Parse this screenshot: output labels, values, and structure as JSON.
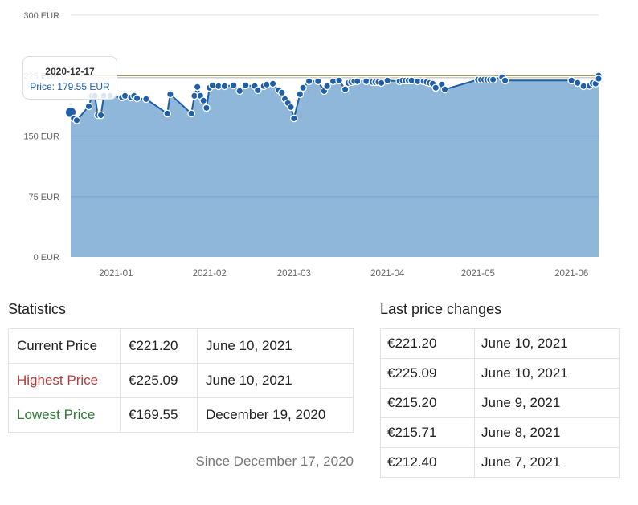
{
  "chart_data": {
    "type": "area",
    "title": "",
    "xlabel": "",
    "ylabel": "",
    "ylim": [
      0,
      300
    ],
    "xlim": [
      "2020-12-17",
      "2021-06-10"
    ],
    "grid": true,
    "y_ticks": [
      "0 EUR",
      "75 EUR",
      "150 EUR",
      "225 EUR",
      "300 EUR"
    ],
    "y_tick_values": [
      0,
      75,
      150,
      225,
      300
    ],
    "x_ticks": [
      "2021-01",
      "2021-02",
      "2021-03",
      "2021-04",
      "2021-05",
      "2021-06"
    ],
    "x_tick_dates": [
      "2021-01-01",
      "2021-02-01",
      "2021-03-01",
      "2021-04-01",
      "2021-05-01",
      "2021-06-01"
    ],
    "reference_lines": [
      {
        "name": "highest",
        "value": 225.09,
        "color": "#8a8a5a"
      },
      {
        "name": "average",
        "value": 222.5,
        "color": "#cccccc"
      }
    ],
    "series": [
      {
        "name": "Price",
        "color": "#1f5ea8",
        "fill": "#8fb7d9",
        "points": [
          [
            "2020-12-17",
            179.55
          ],
          [
            "2020-12-18",
            172
          ],
          [
            "2020-12-19",
            169.55
          ],
          [
            "2020-12-23",
            187
          ],
          [
            "2020-12-24",
            200
          ],
          [
            "2020-12-25",
            200
          ],
          [
            "2020-12-26",
            176
          ],
          [
            "2020-12-27",
            176
          ],
          [
            "2020-12-28",
            200
          ],
          [
            "2020-12-30",
            200
          ],
          [
            "2021-01-03",
            198
          ],
          [
            "2021-01-04",
            200
          ],
          [
            "2021-01-06",
            198
          ],
          [
            "2021-01-07",
            200
          ],
          [
            "2021-01-08",
            197
          ],
          [
            "2021-01-11",
            196
          ],
          [
            "2021-01-18",
            178
          ],
          [
            "2021-01-19",
            202
          ],
          [
            "2021-01-26",
            178
          ],
          [
            "2021-01-27",
            200
          ],
          [
            "2021-01-28",
            211
          ],
          [
            "2021-01-29",
            200
          ],
          [
            "2021-01-30",
            194
          ],
          [
            "2021-01-31",
            185
          ],
          [
            "2021-02-01",
            210
          ],
          [
            "2021-02-02",
            213
          ],
          [
            "2021-02-04",
            212
          ],
          [
            "2021-02-06",
            212
          ],
          [
            "2021-02-09",
            213
          ],
          [
            "2021-02-11",
            206
          ],
          [
            "2021-02-13",
            213
          ],
          [
            "2021-02-16",
            212
          ],
          [
            "2021-02-17",
            207
          ],
          [
            "2021-02-19",
            212
          ],
          [
            "2021-02-20",
            214
          ],
          [
            "2021-02-22",
            215
          ],
          [
            "2021-02-24",
            207
          ],
          [
            "2021-02-25",
            204
          ],
          [
            "2021-02-26",
            196
          ],
          [
            "2021-02-27",
            191
          ],
          [
            "2021-02-28",
            186
          ],
          [
            "2021-03-01",
            172
          ],
          [
            "2021-03-03",
            202
          ],
          [
            "2021-03-04",
            210
          ],
          [
            "2021-03-06",
            218
          ],
          [
            "2021-03-09",
            218
          ],
          [
            "2021-03-11",
            206
          ],
          [
            "2021-03-12",
            212
          ],
          [
            "2021-03-14",
            218
          ],
          [
            "2021-03-16",
            219
          ],
          [
            "2021-03-18",
            208
          ],
          [
            "2021-03-19",
            216
          ],
          [
            "2021-03-20",
            217
          ],
          [
            "2021-03-21",
            218
          ],
          [
            "2021-03-22",
            218
          ],
          [
            "2021-03-25",
            218
          ],
          [
            "2021-03-27",
            217
          ],
          [
            "2021-03-28",
            217
          ],
          [
            "2021-03-29",
            217
          ],
          [
            "2021-03-30",
            216
          ],
          [
            "2021-04-01",
            219
          ],
          [
            "2021-04-05",
            218
          ],
          [
            "2021-04-06",
            219
          ],
          [
            "2021-04-07",
            219
          ],
          [
            "2021-04-08",
            219
          ],
          [
            "2021-04-09",
            219
          ],
          [
            "2021-04-11",
            218
          ],
          [
            "2021-04-13",
            218
          ],
          [
            "2021-04-14",
            217
          ],
          [
            "2021-04-15",
            216
          ],
          [
            "2021-04-16",
            215
          ],
          [
            "2021-04-17",
            210
          ],
          [
            "2021-04-19",
            214
          ],
          [
            "2021-04-20",
            208
          ],
          [
            "2021-05-01",
            220
          ],
          [
            "2021-05-02",
            220
          ],
          [
            "2021-05-03",
            220
          ],
          [
            "2021-05-04",
            220
          ],
          [
            "2021-05-05",
            220
          ],
          [
            "2021-05-06",
            220
          ],
          [
            "2021-05-09",
            223
          ],
          [
            "2021-05-10",
            219
          ],
          [
            "2021-06-01",
            219
          ],
          [
            "2021-06-03",
            216
          ],
          [
            "2021-06-05",
            212
          ],
          [
            "2021-06-07",
            212.4
          ],
          [
            "2021-06-08",
            215.71
          ],
          [
            "2021-06-09",
            215.2
          ],
          [
            "2021-06-10",
            225.09
          ],
          [
            "2021-06-10",
            221.2
          ]
        ]
      }
    ],
    "tooltip": {
      "date": "2020-12-17",
      "label": "Price: 179.55 EUR"
    }
  },
  "statistics": {
    "title": "Statistics",
    "rows": [
      {
        "label": "Current Price",
        "price": "€221.20",
        "date": "June 10, 2021",
        "color": "#222222"
      },
      {
        "label": "Highest Price",
        "price": "€225.09",
        "date": "June 10, 2021",
        "color": "#b83a3a"
      },
      {
        "label": "Lowest Price",
        "price": "€169.55",
        "date": "December 19, 2020",
        "color": "#2f7a34"
      }
    ],
    "since": "Since December 17, 2020"
  },
  "last_changes": {
    "title": "Last price changes",
    "rows": [
      {
        "price": "€221.20",
        "date": "June 10, 2021"
      },
      {
        "price": "€225.09",
        "date": "June 10, 2021"
      },
      {
        "price": "€215.20",
        "date": "June 9, 2021"
      },
      {
        "price": "€215.71",
        "date": "June 8, 2021"
      },
      {
        "price": "€212.40",
        "date": "June 7, 2021"
      }
    ]
  }
}
